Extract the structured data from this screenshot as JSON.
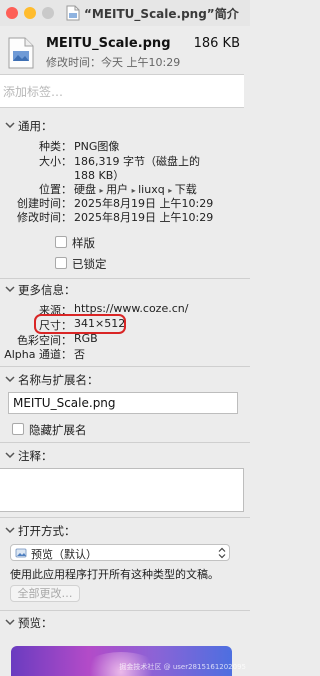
{
  "window": {
    "title": "“MEITU_Scale.png”简介"
  },
  "header": {
    "file_name": "MEITU_Scale.png",
    "file_size": "186 KB",
    "modified": "修改时间：今天 上午10:29"
  },
  "tags": {
    "placeholder": "添加标签…"
  },
  "general": {
    "title": "通用：",
    "kind_label": "种类：",
    "kind_value": "PNG图像",
    "size_label": "大小：",
    "size_value_line1": "186,319 字节（磁盘上的",
    "size_value_line2": "188 KB）",
    "where_label": "位置：",
    "where_path": [
      "硬盘",
      "用户",
      "liuxq",
      "下载"
    ],
    "created_label": "创建时间：",
    "created_value": "2025年8月19日 上午10:29",
    "modified_label": "修改时间：",
    "modified_value": "2025年8月19日 上午10:29",
    "stationery_label": "样版",
    "locked_label": "已锁定"
  },
  "more_info": {
    "title": "更多信息：",
    "source_label": "来源：",
    "source_value": "https://www.coze.cn/",
    "dimensions_label": "尺寸：",
    "dimensions_value": "341×512",
    "color_space_label": "色彩空间：",
    "color_space_value": "RGB",
    "alpha_label": "Alpha 通道：",
    "alpha_value": "否"
  },
  "name_ext": {
    "title": "名称与扩展名：",
    "field_value": "MEITU_Scale.png",
    "hide_ext_label": "隐藏扩展名"
  },
  "comments": {
    "title": "注释："
  },
  "open_with": {
    "title": "打开方式：",
    "app_value": "预览（默认）",
    "description": "使用此应用程序打开所有这种类型的文稿。",
    "change_all_label": "全部更改…"
  },
  "preview": {
    "title": "预览：",
    "watermark": "掘金技术社区 @ user2815161202095"
  },
  "colors": {
    "highlight": "#d92525",
    "close": "#fe5f57",
    "minimize": "#ffbc2e"
  }
}
